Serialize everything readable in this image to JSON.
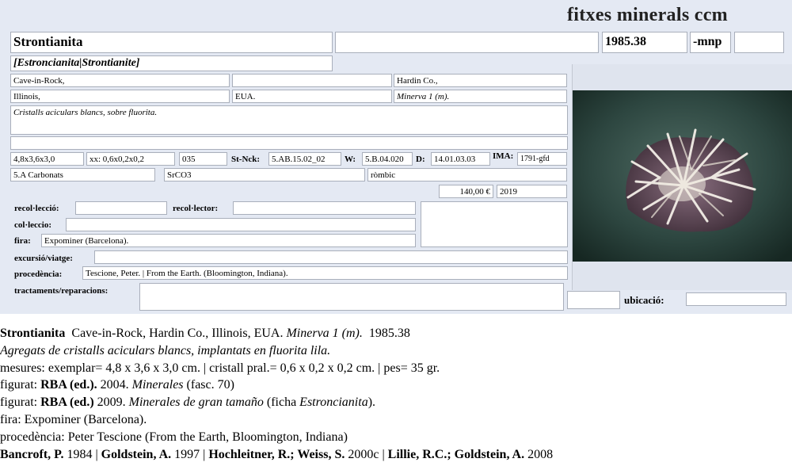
{
  "header": {
    "title": "fitxes minerals ccm"
  },
  "card": {
    "name": "Strontianita",
    "synonyms": "[Estroncianita|Strontianite]",
    "name_extra": "",
    "catalog_number": "1985.38",
    "suffix": "-mnp",
    "suffix_extra": "",
    "locality": "Cave-in-Rock,",
    "locality_extra": "",
    "county": "Hardin Co.,",
    "state": "Illinois,",
    "country": "EUA.",
    "mine": "Minerva 1 (m).",
    "description": "Cristalls aciculars blancs, sobre fluorita.",
    "description_extra": "",
    "specimen_size": "4,8x3,6x3,0",
    "crystal_size": "xx: 0,6x0,2x0,2",
    "weight": "035",
    "strunz_label": "St-Nck:",
    "strunz_value": "5.AB.15.02_02",
    "w_label": "W:",
    "w_value": "5.B.04.020",
    "d_label": "D:",
    "d_value": "14.01.03.03",
    "ima_label": "IMA:",
    "ima_value": "1791-gfd",
    "class": "5.A Carbonats",
    "formula": "SrCO3",
    "crystal_system": "ròmbic",
    "price": "140,00 €",
    "year": "2019"
  },
  "labels": {
    "collection_label": "recol·lecció:",
    "collector_label": "recol·lector:",
    "coleccio_label": "col·leccio:",
    "fair_label": "fira:",
    "excursion_label": "excursió/viatge:",
    "origin_label": "procedència:",
    "treatments_label": "tractaments/reparacions:",
    "location_label": "ubicació:"
  },
  "values": {
    "fair": "Expominer (Barcelona).",
    "origin": "Tescione, Peter. | From the Earth. (Bloomington, Indiana).",
    "collection": "",
    "collector": "",
    "coleccio": "",
    "excursion": "",
    "treatments": "",
    "location": ""
  },
  "caption": {
    "l1_name": "Strontianita",
    "l1_loc": "Cave-in-Rock, Hardin Co., Illinois, EUA.",
    "l1_mine": "Minerva 1 (m).",
    "l1_num": "1985.38",
    "l2": "Agregats de cristalls aciculars blancs, implantats en fluorita lila.",
    "l3": "mesures: exemplar=  4,8 x 3,6 x 3,0 cm. | cristall pral.=  0,6 x 0,2 x 0,2 cm. | pes= 35 gr.",
    "l4_a": "figurat: ",
    "l4_b": "RBA (ed.).",
    "l4_c": " 2004. ",
    "l4_d": "Minerales",
    "l4_e": " (fasc. 70)",
    "l5_a": "figurat: ",
    "l5_b": "RBA (ed.)",
    "l5_c": " 2009. ",
    "l5_d": "Minerales de gran tamaño",
    "l5_e": " (ficha ",
    "l5_f": "Estroncianita",
    "l5_g": ").",
    "l6": "fira: Expominer (Barcelona).",
    "l7": "procedència: Peter Tescione (From the Earth, Bloomington, Indiana)",
    "l8_a": "Bancroft, P.",
    "l8_b": " 1984 | ",
    "l8_c": "Goldstein, A.",
    "l8_d": " 1997 | ",
    "l8_e": "Hochleitner, R.; Weiss, S.",
    "l8_f": " 2000c | ",
    "l8_g": "Lillie, R.C.; Goldstein, A.",
    "l8_h": " 2008"
  }
}
